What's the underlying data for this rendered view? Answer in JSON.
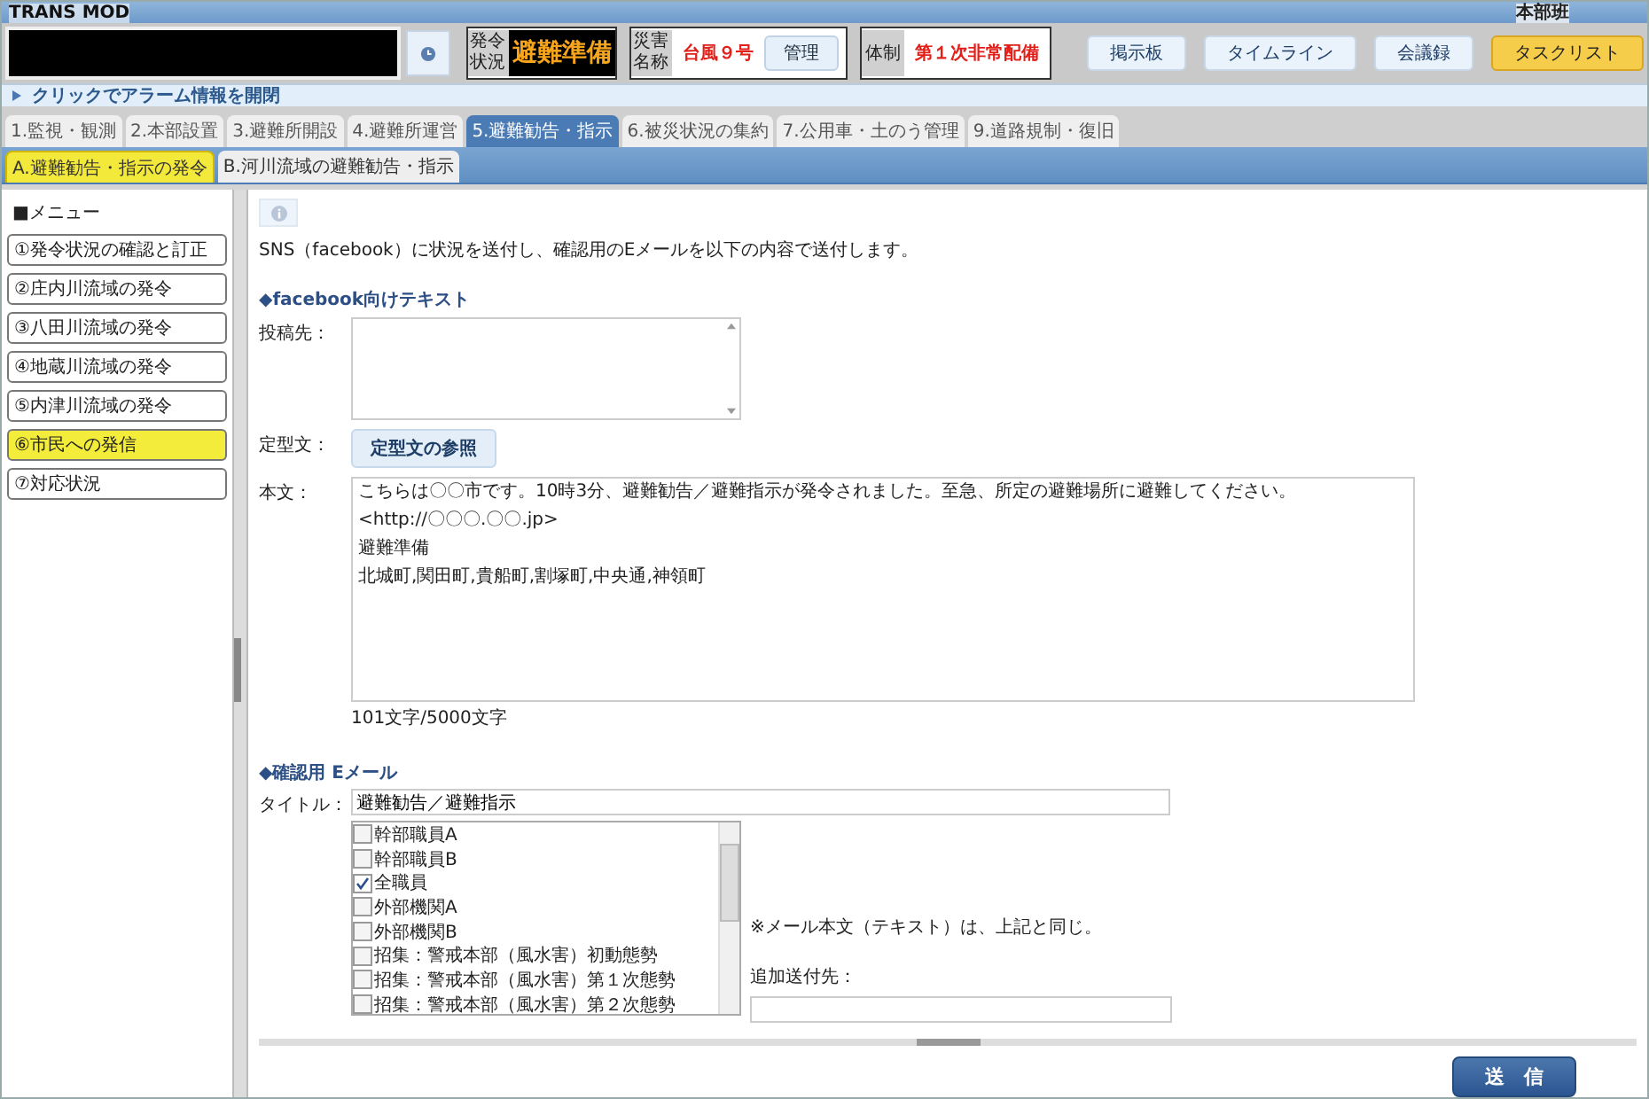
{
  "app": {
    "title": "TRANS MOD",
    "user": "本部班"
  },
  "header": {
    "status_label": "発令状況",
    "status_value": "避難準備",
    "disaster_label": "災害名称",
    "disaster_name": "台風９号",
    "manage_button": "管理",
    "system_label": "体制",
    "system_value": "第１次非常配備",
    "buttons": [
      {
        "label": "掲示板",
        "highlighted": false
      },
      {
        "label": "タイムライン",
        "highlighted": false
      },
      {
        "label": "会議録",
        "highlighted": false
      },
      {
        "label": "タスクリスト",
        "highlighted": true
      }
    ]
  },
  "alarm_bar": {
    "label": "クリックでアラーム情報を開閉"
  },
  "tabs": [
    {
      "label": "1.監視・観測",
      "selected": false
    },
    {
      "label": "2.本部設置",
      "selected": false
    },
    {
      "label": "3.避難所開設",
      "selected": false
    },
    {
      "label": "4.避難所運営",
      "selected": false
    },
    {
      "label": "5.避難勧告・指示",
      "selected": true
    },
    {
      "label": "6.被災状況の集約",
      "selected": false
    },
    {
      "label": "7.公用車・土のう管理",
      "selected": false
    },
    {
      "label": "9.道路規制・復旧",
      "selected": false
    }
  ],
  "subtabs": [
    {
      "label": "A.避難勧告・指示の発令",
      "selected": true
    },
    {
      "label": "B.河川流域の避難勧告・指示",
      "selected": false
    }
  ],
  "sidebar": {
    "heading": "■メニュー",
    "items": [
      {
        "label": "①発令状況の確認と訂正",
        "selected": false
      },
      {
        "label": "②庄内川流域の発令",
        "selected": false
      },
      {
        "label": "③八田川流域の発令",
        "selected": false
      },
      {
        "label": "④地蔵川流域の発令",
        "selected": false
      },
      {
        "label": "⑤内津川流域の発令",
        "selected": false
      },
      {
        "label": "⑥市民への発信",
        "selected": true
      },
      {
        "label": "⑦対応状況",
        "selected": false
      }
    ]
  },
  "content": {
    "intro": "SNS（facebook）に状況を送付し、確認用のEメールを以下の内容で送付します。",
    "facebook": {
      "heading": "◆facebook向けテキスト",
      "post_to_label": "投稿先：",
      "template_label": "定型文：",
      "template_button": "定型文の参照",
      "body_label": "本文：",
      "body_lines": [
        "こちらは〇〇市です。10時3分、避難勧告／避難指示が発令されました。至急、所定の避難場所に避難してください。",
        "<http://〇〇〇.〇〇.jp>",
        "避難準備",
        "北城町,関田町,貴船町,割塚町,中央通,神領町"
      ],
      "counter": "101文字/5000文字"
    },
    "email": {
      "heading": "◆確認用 Eメール",
      "title_label": "タイトル：",
      "title_value": "避難勧告／避難指示",
      "recipients": [
        {
          "label": "幹部職員A",
          "checked": false
        },
        {
          "label": "幹部職員B",
          "checked": false
        },
        {
          "label": "全職員",
          "checked": true
        },
        {
          "label": "外部機関A",
          "checked": false
        },
        {
          "label": "外部機関B",
          "checked": false
        },
        {
          "label": "招集：警戒本部（風水害）初動態勢",
          "checked": false
        },
        {
          "label": "招集：警戒本部（風水害）第１次態勢",
          "checked": false
        },
        {
          "label": "招集：警戒本部（風水害）第２次態勢",
          "checked": false
        }
      ],
      "note": "※メール本文（テキスト）は、上記と同じ。",
      "extra_label": "追加送付先："
    },
    "send_button": "送　信"
  }
}
